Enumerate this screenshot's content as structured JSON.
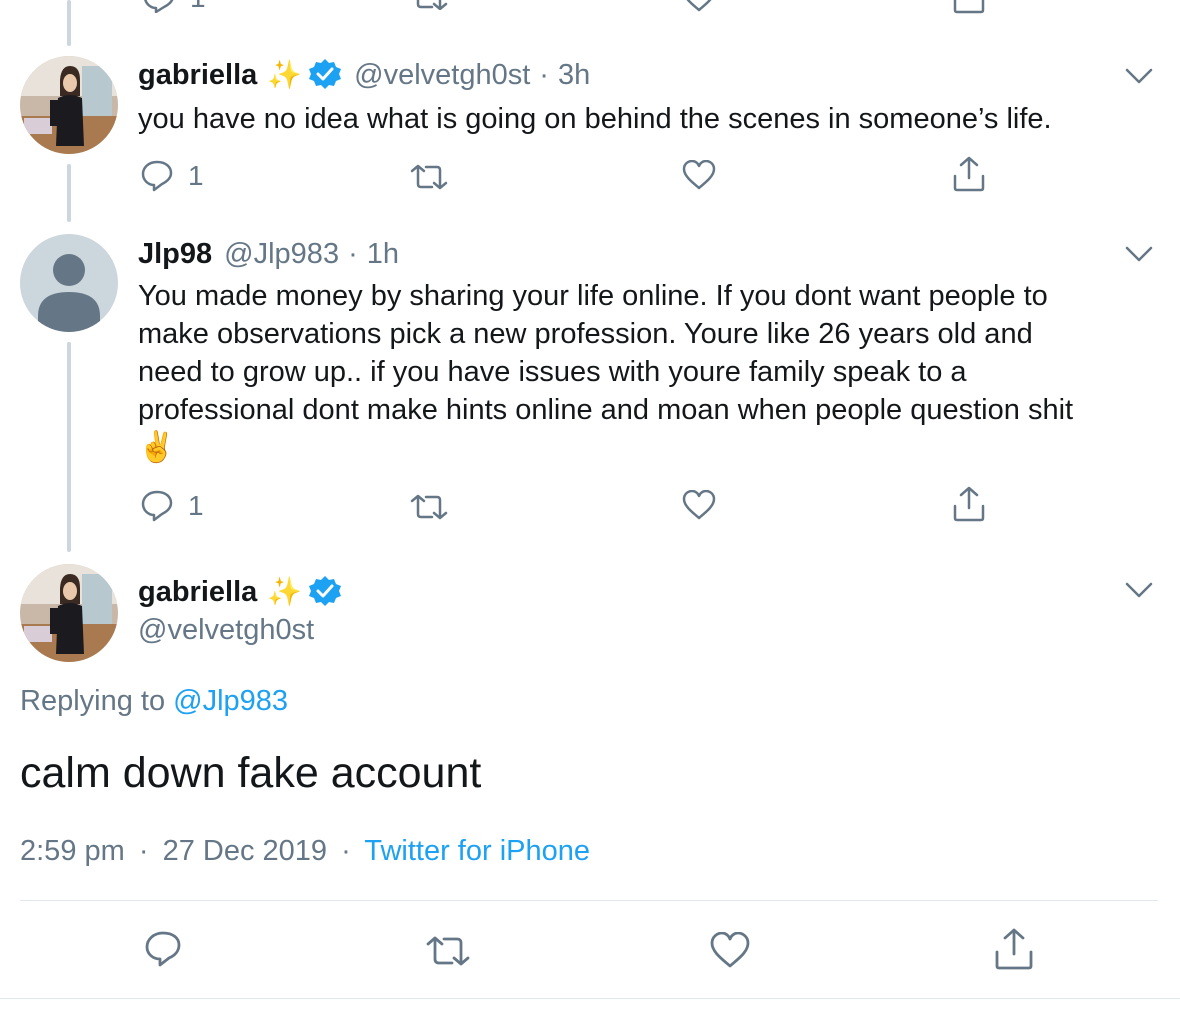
{
  "colors": {
    "text": "#14171a",
    "secondary": "#657786",
    "link": "#1da1f2",
    "verified": "#1da1f2",
    "thread_line": "#ccd6dd",
    "divider": "#e1e8ed"
  },
  "top_partial_actions": {
    "reply_count": "1"
  },
  "tweets": [
    {
      "display_name": "gabriella",
      "badge": "✨",
      "verified": true,
      "handle": "@velvetgh0st",
      "separator": "·",
      "time": "3h",
      "text": "you have no idea what is going on behind the scenes in someone’s life.",
      "reply_count": "1",
      "avatar_icon": "profile-photo"
    },
    {
      "display_name": "Jlp98",
      "verified": false,
      "handle": "@Jlp983",
      "separator": "·",
      "time": "1h",
      "text_lines": [
        "You made money by sharing your life online. If you dont want people to",
        "make observations pick a new profession. Youre like 26 years old and",
        "need to grow up.. if you have issues with youre family speak to a",
        "professional dont make hints online and moan when people question shit",
        "✌️"
      ],
      "reply_count": "1",
      "avatar_icon": "default-avatar"
    }
  ],
  "focused_tweet": {
    "display_name": "gabriella",
    "badge": "✨",
    "verified": true,
    "handle": "@velvetgh0st",
    "replying_to_label": "Replying to",
    "replying_to_handle": "@Jlp983",
    "text": "calm down fake account",
    "time": "2:59 pm",
    "separator": "·",
    "date": "27 Dec 2019",
    "source": "Twitter for iPhone"
  },
  "icons": [
    "reply-icon",
    "retweet-icon",
    "like-icon",
    "share-icon",
    "chevron-down-icon",
    "verified-badge-icon"
  ]
}
